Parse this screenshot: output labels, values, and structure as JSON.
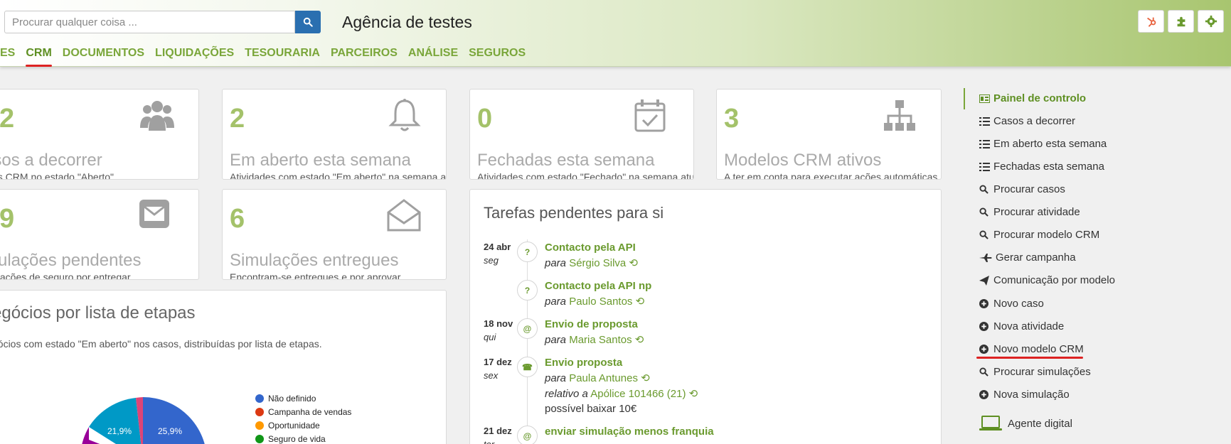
{
  "search": {
    "placeholder": "Procurar qualquer coisa ..."
  },
  "header": {
    "agency": "Agência de testes"
  },
  "nav": [
    "ES",
    "CRM",
    "DOCUMENTOS",
    "LIQUIDAÇÕES",
    "TESOURARIA",
    "PARCEIROS",
    "ANÁLISE",
    "SEGUROS"
  ],
  "cards": [
    {
      "num": "2",
      "title": "asos a decorrer",
      "sub": "os CRM no estado \"Aberto\"",
      "icon": "users-icon"
    },
    {
      "num": "2",
      "title": "Em aberto esta semana",
      "sub": "Atividades com estado \"Em aberto\" na semana a...",
      "icon": "bell-icon"
    },
    {
      "num": "0",
      "title": "Fechadas esta semana",
      "sub": "Atividades com estado \"Fechado\" na semana atu...",
      "icon": "calendar-check-icon"
    },
    {
      "num": "3",
      "title": "Modelos CRM ativos",
      "sub": "A ter em conta para executar ações automáticas",
      "icon": "sitemap-icon"
    },
    {
      "num": "9",
      "title": "mulações pendentes",
      "sub": "ulações de seguro por entregar",
      "icon": "envelope-icon"
    },
    {
      "num": "6",
      "title": "Simulações entregues",
      "sub": "Encontram-se entregues e por aprovar",
      "icon": "envelope-open-icon"
    }
  ],
  "pie": {
    "title": "egócios por lista de etapas",
    "desc": "gócios com estado \"Em aberto\" nos casos, distribuídas por lista de etapas.",
    "labels": [
      "21,9%",
      "25,9%"
    ]
  },
  "chart_data": {
    "type": "pie",
    "categories": [
      "Não definido",
      "Campanha de vendas",
      "Oportunidade",
      "Seguro de vida"
    ],
    "colors": [
      "#3366cc",
      "#dc3912",
      "#ff9900",
      "#109618"
    ],
    "visible_labels": [
      "25,9%",
      "21,9%"
    ]
  },
  "tasks": {
    "title": "Tarefas pendentes para si",
    "items": [
      {
        "date": "24 abr",
        "day": "seg",
        "icon": "?",
        "title": "Contacto pela API",
        "para_label": "para",
        "para": "Sérgio Silva"
      },
      {
        "date": "",
        "day": "",
        "icon": "?",
        "title": "Contacto pela API np",
        "para_label": "para",
        "para": "Paulo Santos"
      },
      {
        "date": "18 nov",
        "day": "qui",
        "icon": "@",
        "title": "Envio de proposta",
        "para_label": "para",
        "para": "Maria Santos"
      },
      {
        "date": "17 dez",
        "day": "sex",
        "icon": "☎",
        "title": "Envio proposta",
        "para_label": "para",
        "para": "Paula Antunes",
        "rel_label": "relativo a",
        "rel": "Apólice 101466 (21)",
        "note": "possível baixar 10€"
      },
      {
        "date": "21 dez",
        "day": "ter",
        "icon": "@",
        "title": "enviar simulação menos franquia"
      }
    ]
  },
  "right_menu": [
    {
      "label": "Painel de controlo",
      "icon": "dashboard-icon"
    },
    {
      "label": "Casos a decorrer",
      "icon": "list-icon"
    },
    {
      "label": "Em aberto esta semana",
      "icon": "list-icon"
    },
    {
      "label": "Fechadas esta semana",
      "icon": "list-icon"
    },
    {
      "label": "Procurar casos",
      "icon": "search-icon"
    },
    {
      "label": "Procurar atividade",
      "icon": "search-icon"
    },
    {
      "label": "Procurar modelo CRM",
      "icon": "search-icon"
    },
    {
      "label": "Gerar campanha",
      "icon": "plane-icon"
    },
    {
      "label": "Comunicação por modelo",
      "icon": "send-icon"
    },
    {
      "label": "Novo caso",
      "icon": "plus-circle-icon"
    },
    {
      "label": "Nova atividade",
      "icon": "plus-circle-icon"
    },
    {
      "label": "Novo modelo CRM",
      "icon": "plus-circle-icon"
    },
    {
      "label": "Procurar simulações",
      "icon": "search-icon"
    },
    {
      "label": "Nova simulação",
      "icon": "plus-circle-icon"
    },
    {
      "label": "Agente digital",
      "icon": "laptop-icon"
    }
  ]
}
